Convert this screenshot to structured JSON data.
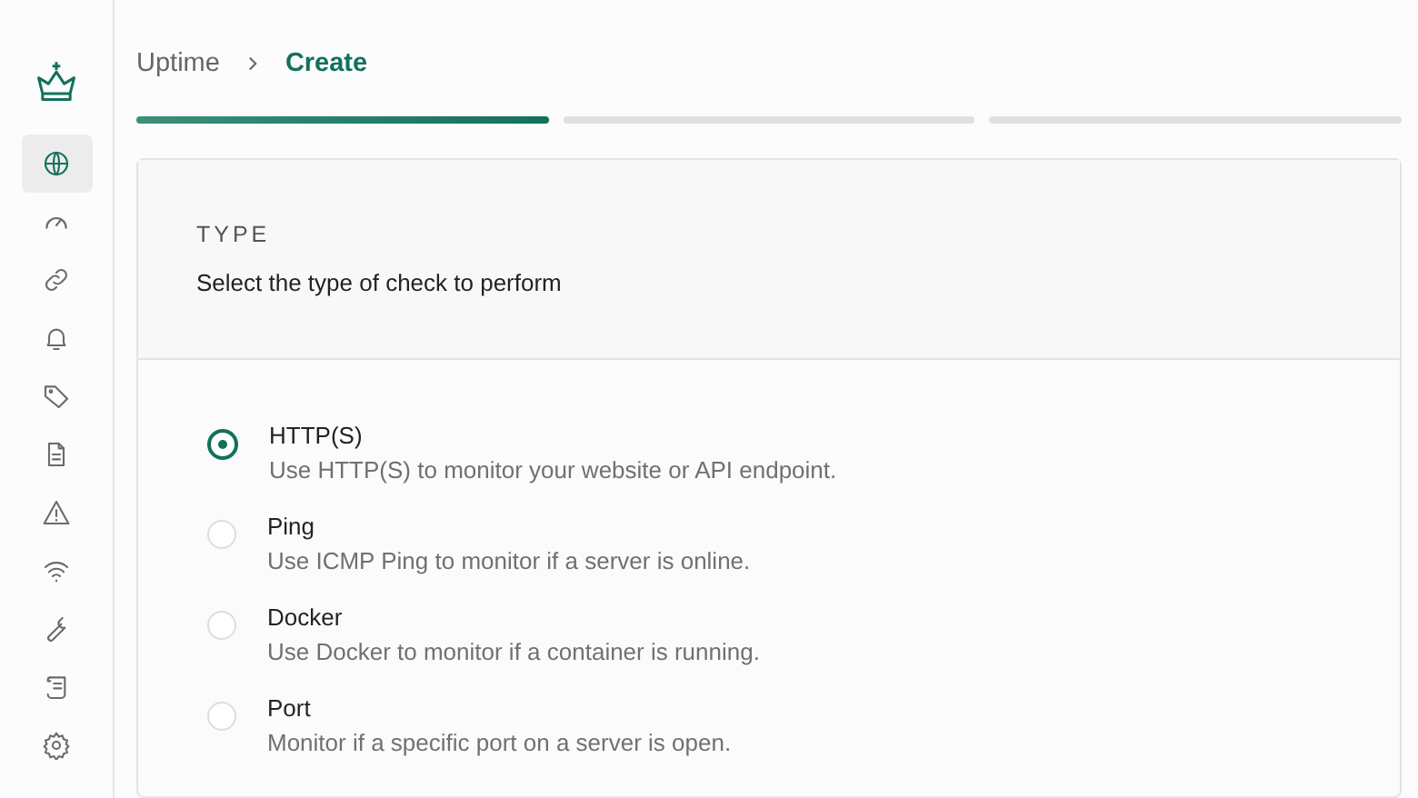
{
  "sidebar": {
    "items": [
      {
        "kind": "globe",
        "selected": true
      },
      {
        "kind": "gauge",
        "selected": false
      },
      {
        "kind": "link",
        "selected": false
      },
      {
        "kind": "bell",
        "selected": false
      },
      {
        "kind": "tag",
        "selected": false
      },
      {
        "kind": "document",
        "selected": false
      },
      {
        "kind": "warning",
        "selected": false
      },
      {
        "kind": "wifi",
        "selected": false
      },
      {
        "kind": "wrench",
        "selected": false
      },
      {
        "kind": "scroll",
        "selected": false
      },
      {
        "kind": "settings",
        "selected": false
      }
    ]
  },
  "breadcrumb": [
    "Uptime",
    "Create"
  ],
  "steps": [
    {
      "active": true
    },
    {
      "active": false
    },
    {
      "active": false
    }
  ],
  "section": {
    "title": "TYPE",
    "subtitle": "Select the type of check to perform"
  },
  "options": [
    {
      "label": "HTTP(S)",
      "description": "Use HTTP(S) to monitor your website or API endpoint.",
      "selected": true
    },
    {
      "label": "Ping",
      "description": "Use ICMP Ping to monitor if a server is online.",
      "selected": false
    },
    {
      "label": "Docker",
      "description": "Use Docker to monitor if a container is running.",
      "selected": false
    },
    {
      "label": "Port",
      "description": "Monitor if a specific port on a server is open.",
      "selected": false
    }
  ]
}
